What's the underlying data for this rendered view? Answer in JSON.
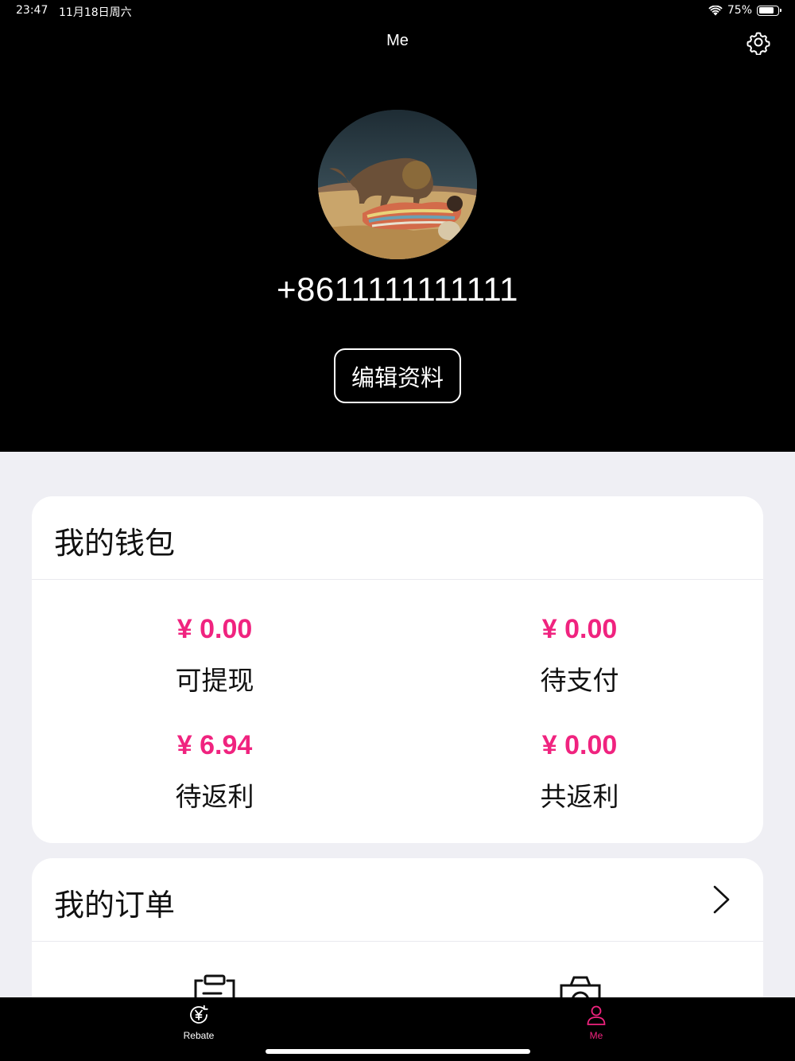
{
  "status_bar": {
    "time": "23:47",
    "date": "11月18日周六",
    "battery": "75%",
    "battery_level": 0.75
  },
  "nav": {
    "title": "Me",
    "settings_icon": "gear-icon"
  },
  "profile": {
    "phone": "+8611111111111",
    "edit_button": "编辑资料"
  },
  "wallet": {
    "title": "我的钱包",
    "items": [
      {
        "amount": "¥ 0.00",
        "label": "可提现"
      },
      {
        "amount": "¥ 0.00",
        "label": "待支付"
      },
      {
        "amount": "¥ 6.94",
        "label": "待返利"
      },
      {
        "amount": "¥ 0.00",
        "label": "共返利"
      }
    ],
    "accent_color": "#f0237f"
  },
  "orders": {
    "title": "我的订单",
    "chevron_icon": "chevron-right-icon",
    "icons": [
      "clipboard-icon",
      "camera-icon"
    ]
  },
  "tabbar": {
    "tabs": [
      {
        "label": "Rebate",
        "icon": "yen-refresh-icon",
        "active": false
      },
      {
        "label": "Me",
        "icon": "person-icon",
        "active": true
      }
    ],
    "active_color": "#f0237f"
  }
}
